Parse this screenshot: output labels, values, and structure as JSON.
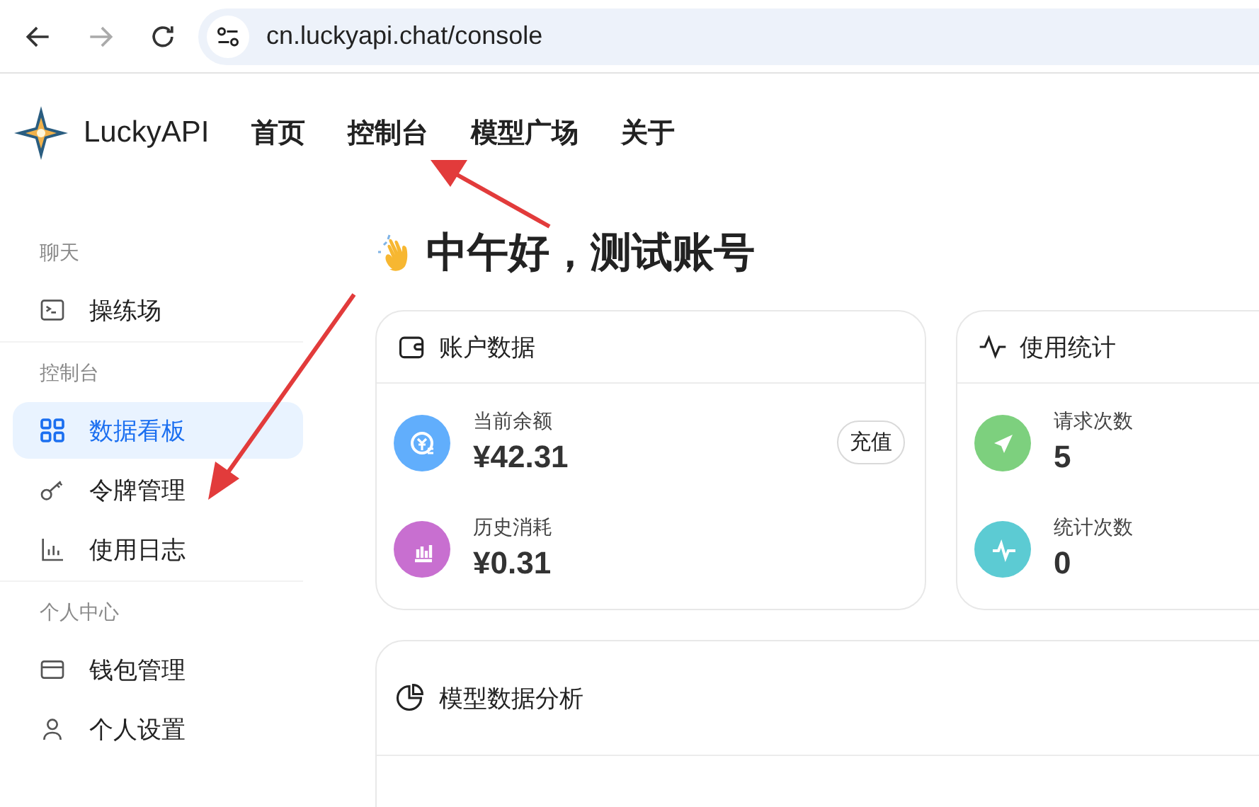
{
  "browser": {
    "url": "cn.luckyapi.chat/console"
  },
  "header": {
    "brand": "LuckyAPI",
    "nav": [
      {
        "label": "首页"
      },
      {
        "label": "控制台"
      },
      {
        "label": "模型广场"
      },
      {
        "label": "关于"
      }
    ]
  },
  "sidebar": {
    "sections": [
      {
        "title": "聊天",
        "items": [
          {
            "label": "操练场",
            "selected": false
          }
        ]
      },
      {
        "title": "控制台",
        "items": [
          {
            "label": "数据看板",
            "selected": true
          },
          {
            "label": "令牌管理",
            "selected": false
          },
          {
            "label": "使用日志",
            "selected": false
          }
        ]
      },
      {
        "title": "个人中心",
        "items": [
          {
            "label": "钱包管理",
            "selected": false
          },
          {
            "label": "个人设置",
            "selected": false
          }
        ]
      }
    ]
  },
  "greeting": "中午好，测试账号",
  "cards": [
    {
      "title": "账户数据",
      "stats": [
        {
          "label": "当前余额",
          "value": "¥42.31",
          "color": "#61aefc",
          "action": "充值"
        },
        {
          "label": "历史消耗",
          "value": "¥0.31",
          "color": "#c86fd0"
        }
      ]
    },
    {
      "title": "使用统计",
      "stats": [
        {
          "label": "请求次数",
          "value": "5",
          "color": "#7dd07e"
        },
        {
          "label": "统计次数",
          "value": "0",
          "color": "#5ccbd3"
        }
      ]
    }
  ],
  "panel": {
    "title": "模型数据分析"
  }
}
